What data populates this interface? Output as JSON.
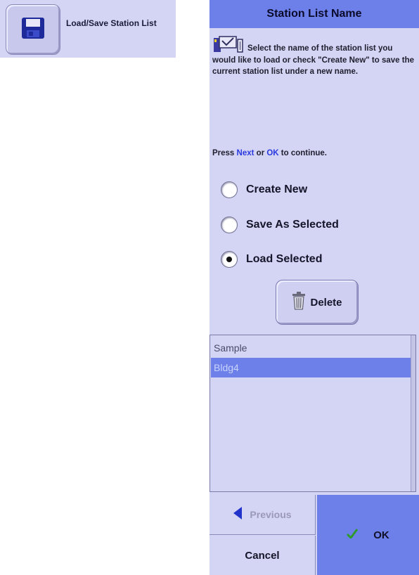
{
  "launcher": {
    "label": "Load/Save Station List",
    "icon": "floppy-disk-icon"
  },
  "dialog": {
    "title": "Station List Name",
    "instructions": "Select the name of the station list you would like to load or check \"Create New\" to save the current station list under a new name.",
    "press_prefix": "Press ",
    "press_next": "Next",
    "press_or": " or ",
    "press_ok": "OK",
    "press_suffix": " to continue."
  },
  "options": [
    {
      "label": "Create New",
      "selected": false
    },
    {
      "label": "Save As Selected",
      "selected": false
    },
    {
      "label": "Load Selected",
      "selected": true
    }
  ],
  "delete_label": "Delete",
  "station_lists": [
    {
      "label": "Sample",
      "selected": false
    },
    {
      "label": "Bldg4",
      "selected": true
    }
  ],
  "footer": {
    "previous_label": "Previous",
    "cancel_label": "Cancel",
    "ok_label": "OK"
  },
  "colors": {
    "panel": "#d4d4f4",
    "accent": "#6d7fe8",
    "link": "#2a3ae0",
    "ok_check": "#2e9a2e",
    "back_arrow": "#2233cc"
  }
}
